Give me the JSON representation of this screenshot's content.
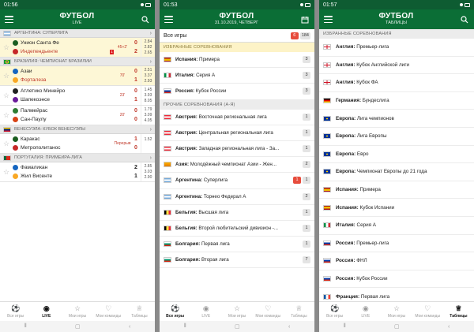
{
  "colors": {
    "brand": "#0b6e36",
    "status_bar": "#0e5c32",
    "live_red": "#c0392b",
    "highlight": "#fdf7d6"
  },
  "screens": [
    {
      "status": {
        "time": "01:56"
      },
      "header": {
        "title": "ФУТБОЛ",
        "subtitle": "LIVE",
        "right_icon": "search-icon"
      },
      "leagues": [
        {
          "name": "АРГЕНТИНА: СУПЕРЛИГА",
          "flag": "argentina",
          "matches": [
            {
              "home": "Унион Санта Фе",
              "away": "Индепендьенте",
              "away_red_cards": "1",
              "minute": "45+2'",
              "home_score": "0",
              "away_score": "2",
              "score_red": true,
              "highlight": true,
              "odds": [
                "2.84",
                "2.82",
                "2.65"
              ],
              "home_red_name": false,
              "away_red_name": true
            }
          ]
        },
        {
          "name": "БРАЗИЛИЯ: ЧЕМПИОНАТ БРАЗИЛИИ",
          "flag": "brazil",
          "matches": [
            {
              "home": "Азаи",
              "away": "Форталеза",
              "minute": "70'",
              "home_score": "0",
              "away_score": "1",
              "score_red": true,
              "highlight": true,
              "odds": [
                "2.51",
                "3.37",
                "2.93"
              ],
              "home_red_name": false,
              "away_red_name": true
            },
            {
              "home": "Атлетико Минейро",
              "away": "Шапекоэнсе",
              "minute": "23'",
              "home_score": "0",
              "away_score": "1",
              "score_red": true,
              "highlight": false,
              "odds": [
                "1.45",
                "3.93",
                "8.05"
              ],
              "home_red_name": false,
              "away_red_name": false
            },
            {
              "home": "Палмейрас",
              "away": "Сан-Паулу",
              "minute": "20'",
              "home_score": "0",
              "away_score": "0",
              "score_red": true,
              "highlight": false,
              "odds": [
                "1.79",
                "3.09",
                "4.05"
              ],
              "home_red_name": false,
              "away_red_name": false
            }
          ]
        },
        {
          "name": "ВЕНЕСУЭЛА: КУБОК ВЕНЕСУЭЛЫ",
          "flag": "venezuela",
          "matches": [
            {
              "home": "Каракас",
              "away": "Метрополитанос",
              "minute": "Перерыв",
              "home_score": "1",
              "away_score": "0",
              "score_red": true,
              "highlight": false,
              "odds": [
                "1.52",
                "",
                ""
              ],
              "home_red_name": false,
              "away_red_name": false
            }
          ]
        },
        {
          "name": "ПОРТУГАЛИЯ: ПРИМЕЙРА-ЛИГА",
          "flag": "portugal",
          "matches": [
            {
              "home": "Фамаликан",
              "away": "Жил Висенте",
              "minute": "",
              "home_score": "2",
              "away_score": "1",
              "score_red": false,
              "highlight": false,
              "odds": [
                "2.85",
                "3.03",
                "2.90"
              ],
              "home_red_name": false,
              "away_red_name": false
            }
          ]
        }
      ],
      "tabs": [
        {
          "label": "Все игры",
          "icon": "ball-icon",
          "glyph": "⚽",
          "active": false
        },
        {
          "label": "LIVE",
          "icon": "live-icon",
          "glyph": "◉",
          "active": true
        },
        {
          "label": "Мои игры",
          "icon": "star-icon",
          "glyph": "☆",
          "active": false
        },
        {
          "label": "Мои команды",
          "icon": "heart-icon",
          "glyph": "♡",
          "active": false
        },
        {
          "label": "Таблицы",
          "icon": "trophy-icon",
          "glyph": "♕",
          "active": false
        }
      ]
    },
    {
      "status": {
        "time": "01:53"
      },
      "header": {
        "title": "ФУТБОЛ",
        "subtitle": "31.10.2019, ЧЕТВЕРГ",
        "right_icon": "calendar-icon"
      },
      "all_games": {
        "label": "Все игры",
        "live_count": "6",
        "total_count": "184"
      },
      "favourites_header": "ИЗБРАННЫЕ СОРЕВНОВАНИЯ",
      "favourites": [
        {
          "flag": "spain",
          "country": "Испания:",
          "league": "Примера",
          "count": "3",
          "live": false
        },
        {
          "flag": "italy",
          "country": "Италия:",
          "league": "Серия А",
          "count": "3",
          "live": false
        },
        {
          "flag": "russia",
          "country": "Россия:",
          "league": "Кубок России",
          "count": "3",
          "live": false
        }
      ],
      "other_header": "ПРОЧИЕ СОРЕВНОВАНИЯ (А-Я)",
      "others": [
        {
          "flag": "austria",
          "country": "Австрия:",
          "league": "Восточная региональная лига",
          "count": "1",
          "live": false
        },
        {
          "flag": "austria",
          "country": "Австрия:",
          "league": "Центральная региональная лига",
          "count": "1",
          "live": false
        },
        {
          "flag": "austria",
          "country": "Австрия:",
          "league": "Западная региональная лига - За...",
          "count": "1",
          "live": false
        },
        {
          "flag": "asia",
          "country": "Азия:",
          "league": "Молодёжный чемпионат Азии - Жен...",
          "count": "2",
          "live": false
        },
        {
          "flag": "argentina",
          "country": "Аргентина:",
          "league": "Суперлига",
          "count": "1",
          "live": true,
          "extra": "1"
        },
        {
          "flag": "argentina",
          "country": "Аргентина:",
          "league": "Торнео Федерал А",
          "count": "2",
          "live": false
        },
        {
          "flag": "belgium",
          "country": "Бельгия:",
          "league": "Высшая лига",
          "count": "1",
          "live": false
        },
        {
          "flag": "belgium",
          "country": "Бельгия:",
          "league": "Второй любительский дивизион -...",
          "count": "1",
          "live": false
        },
        {
          "flag": "bulgaria",
          "country": "Болгария:",
          "league": "Первая лига",
          "count": "1",
          "live": false
        },
        {
          "flag": "bulgaria",
          "country": "Болгария:",
          "league": "Вторая лига",
          "count": "7",
          "live": false
        }
      ],
      "tabs": [
        {
          "label": "Все игры",
          "icon": "ball-icon",
          "glyph": "⚽",
          "active": true
        },
        {
          "label": "LIVE",
          "icon": "live-icon",
          "glyph": "◉",
          "active": false
        },
        {
          "label": "Мои игры",
          "icon": "star-icon",
          "glyph": "☆",
          "active": false
        },
        {
          "label": "Мои команды",
          "icon": "heart-icon",
          "glyph": "♡",
          "active": false
        },
        {
          "label": "Таблицы",
          "icon": "trophy-icon",
          "glyph": "♕",
          "active": false
        }
      ]
    },
    {
      "status": {
        "time": "01:57"
      },
      "header": {
        "title": "ФУТБОЛ",
        "subtitle": "ТАБЛИЦЫ",
        "right_icon": "search-icon"
      },
      "section_header": "ИЗБРАННЫЕ СОРЕВНОВАНИЯ",
      "tables": [
        {
          "flag": "england",
          "country": "Англия:",
          "league": "Премьер-лига"
        },
        {
          "flag": "england",
          "country": "Англия:",
          "league": "Кубок Английской лиги"
        },
        {
          "flag": "england",
          "country": "Англия:",
          "league": "Кубок ФА"
        },
        {
          "flag": "germany",
          "country": "Германия:",
          "league": "Бундеслига"
        },
        {
          "flag": "europe",
          "country": "Европа:",
          "league": "Лига чемпионов"
        },
        {
          "flag": "europe",
          "country": "Европа:",
          "league": "Лига Европы"
        },
        {
          "flag": "europe",
          "country": "Европа:",
          "league": "Евро"
        },
        {
          "flag": "europe",
          "country": "Европа:",
          "league": "Чемпионат Европы до 21 года"
        },
        {
          "flag": "spain",
          "country": "Испания:",
          "league": "Примера"
        },
        {
          "flag": "spain",
          "country": "Испания:",
          "league": "Кубок Испании"
        },
        {
          "flag": "italy",
          "country": "Италия:",
          "league": "Серия А"
        },
        {
          "flag": "russia",
          "country": "Россия:",
          "league": "Премьер-лига"
        },
        {
          "flag": "russia",
          "country": "Россия:",
          "league": "ФНЛ"
        },
        {
          "flag": "russia",
          "country": "Россия:",
          "league": "Кубок России"
        },
        {
          "flag": "france",
          "country": "Франция:",
          "league": "Первая лига"
        }
      ],
      "tabs": [
        {
          "label": "Все игры",
          "icon": "ball-icon",
          "glyph": "⚽",
          "active": false
        },
        {
          "label": "LIVE",
          "icon": "live-icon",
          "glyph": "◉",
          "active": false
        },
        {
          "label": "Мои игры",
          "icon": "star-icon",
          "glyph": "☆",
          "active": false
        },
        {
          "label": "Мои команды",
          "icon": "heart-icon",
          "glyph": "♡",
          "active": false
        },
        {
          "label": "Таблицы",
          "icon": "trophy-icon",
          "glyph": "♕",
          "active": true
        }
      ]
    }
  ]
}
